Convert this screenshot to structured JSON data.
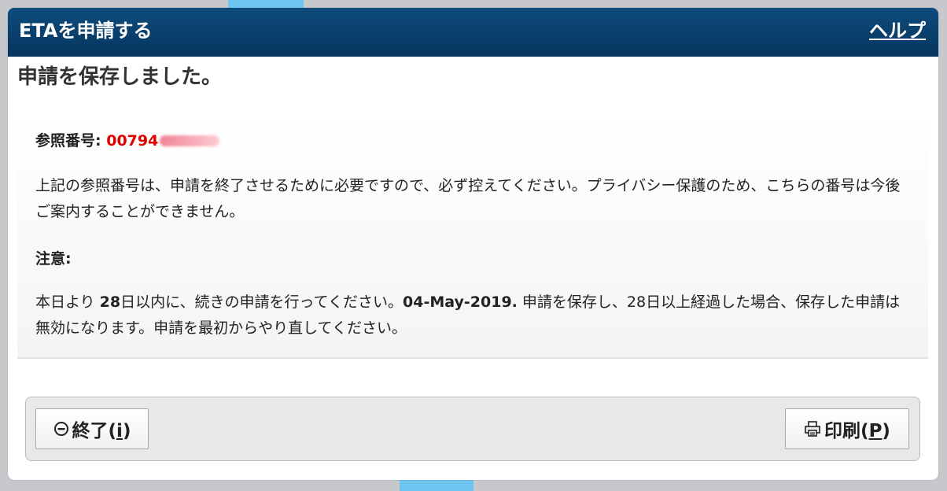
{
  "window": {
    "title": "ETAを申請する",
    "help_label": "ヘルプ"
  },
  "page": {
    "heading": "申請を保存しました。"
  },
  "reference": {
    "label": "参照番号:",
    "number_visible": "00794"
  },
  "info": {
    "paragraph1": "上記の参照番号は、申請を終了させるために必要ですので、必ず控えてください。プライバシー保護のため、こちらの番号は今後ご案内することができません。",
    "notice_label": "注意:",
    "paragraph2_prefix": "本日より ",
    "days": "28",
    "paragraph2_mid": "日以内に、続きの申請を行ってください。",
    "deadline": "04-May-2019.",
    "paragraph2_suffix": " 申請を保存し、28日以上経過した場合、保存した申請は無効になります。申請を最初からやり直してください。"
  },
  "buttons": {
    "exit": {
      "label": "終了(",
      "accesskey": "i",
      "close": ")",
      "icon": "minus-circle-icon"
    },
    "print": {
      "label": "印刷(",
      "accesskey": "P",
      "close": ")",
      "icon": "printer-icon"
    }
  },
  "colors": {
    "title_bar": "#06355f",
    "reference_number": "#e00000",
    "accent_stripe": "#6ec5f2"
  }
}
